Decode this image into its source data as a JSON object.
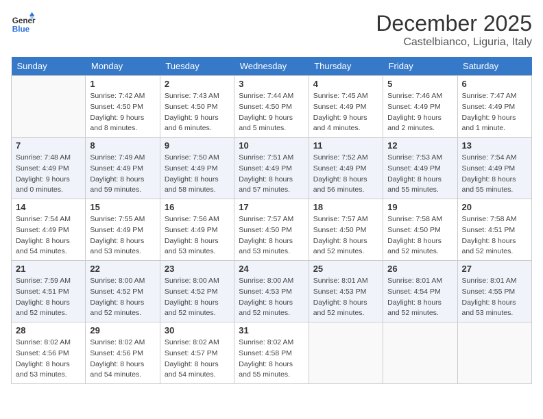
{
  "header": {
    "logo_general": "General",
    "logo_blue": "Blue",
    "month_title": "December 2025",
    "location": "Castelbianco, Liguria, Italy"
  },
  "days_of_week": [
    "Sunday",
    "Monday",
    "Tuesday",
    "Wednesday",
    "Thursday",
    "Friday",
    "Saturday"
  ],
  "weeks": [
    [
      {
        "day": "",
        "sunrise": "",
        "sunset": "",
        "daylight": ""
      },
      {
        "day": "1",
        "sunrise": "Sunrise: 7:42 AM",
        "sunset": "Sunset: 4:50 PM",
        "daylight": "Daylight: 9 hours and 8 minutes."
      },
      {
        "day": "2",
        "sunrise": "Sunrise: 7:43 AM",
        "sunset": "Sunset: 4:50 PM",
        "daylight": "Daylight: 9 hours and 6 minutes."
      },
      {
        "day": "3",
        "sunrise": "Sunrise: 7:44 AM",
        "sunset": "Sunset: 4:50 PM",
        "daylight": "Daylight: 9 hours and 5 minutes."
      },
      {
        "day": "4",
        "sunrise": "Sunrise: 7:45 AM",
        "sunset": "Sunset: 4:49 PM",
        "daylight": "Daylight: 9 hours and 4 minutes."
      },
      {
        "day": "5",
        "sunrise": "Sunrise: 7:46 AM",
        "sunset": "Sunset: 4:49 PM",
        "daylight": "Daylight: 9 hours and 2 minutes."
      },
      {
        "day": "6",
        "sunrise": "Sunrise: 7:47 AM",
        "sunset": "Sunset: 4:49 PM",
        "daylight": "Daylight: 9 hours and 1 minute."
      }
    ],
    [
      {
        "day": "7",
        "sunrise": "Sunrise: 7:48 AM",
        "sunset": "Sunset: 4:49 PM",
        "daylight": "Daylight: 9 hours and 0 minutes."
      },
      {
        "day": "8",
        "sunrise": "Sunrise: 7:49 AM",
        "sunset": "Sunset: 4:49 PM",
        "daylight": "Daylight: 8 hours and 59 minutes."
      },
      {
        "day": "9",
        "sunrise": "Sunrise: 7:50 AM",
        "sunset": "Sunset: 4:49 PM",
        "daylight": "Daylight: 8 hours and 58 minutes."
      },
      {
        "day": "10",
        "sunrise": "Sunrise: 7:51 AM",
        "sunset": "Sunset: 4:49 PM",
        "daylight": "Daylight: 8 hours and 57 minutes."
      },
      {
        "day": "11",
        "sunrise": "Sunrise: 7:52 AM",
        "sunset": "Sunset: 4:49 PM",
        "daylight": "Daylight: 8 hours and 56 minutes."
      },
      {
        "day": "12",
        "sunrise": "Sunrise: 7:53 AM",
        "sunset": "Sunset: 4:49 PM",
        "daylight": "Daylight: 8 hours and 55 minutes."
      },
      {
        "day": "13",
        "sunrise": "Sunrise: 7:54 AM",
        "sunset": "Sunset: 4:49 PM",
        "daylight": "Daylight: 8 hours and 55 minutes."
      }
    ],
    [
      {
        "day": "14",
        "sunrise": "Sunrise: 7:54 AM",
        "sunset": "Sunset: 4:49 PM",
        "daylight": "Daylight: 8 hours and 54 minutes."
      },
      {
        "day": "15",
        "sunrise": "Sunrise: 7:55 AM",
        "sunset": "Sunset: 4:49 PM",
        "daylight": "Daylight: 8 hours and 53 minutes."
      },
      {
        "day": "16",
        "sunrise": "Sunrise: 7:56 AM",
        "sunset": "Sunset: 4:49 PM",
        "daylight": "Daylight: 8 hours and 53 minutes."
      },
      {
        "day": "17",
        "sunrise": "Sunrise: 7:57 AM",
        "sunset": "Sunset: 4:50 PM",
        "daylight": "Daylight: 8 hours and 53 minutes."
      },
      {
        "day": "18",
        "sunrise": "Sunrise: 7:57 AM",
        "sunset": "Sunset: 4:50 PM",
        "daylight": "Daylight: 8 hours and 52 minutes."
      },
      {
        "day": "19",
        "sunrise": "Sunrise: 7:58 AM",
        "sunset": "Sunset: 4:50 PM",
        "daylight": "Daylight: 8 hours and 52 minutes."
      },
      {
        "day": "20",
        "sunrise": "Sunrise: 7:58 AM",
        "sunset": "Sunset: 4:51 PM",
        "daylight": "Daylight: 8 hours and 52 minutes."
      }
    ],
    [
      {
        "day": "21",
        "sunrise": "Sunrise: 7:59 AM",
        "sunset": "Sunset: 4:51 PM",
        "daylight": "Daylight: 8 hours and 52 minutes."
      },
      {
        "day": "22",
        "sunrise": "Sunrise: 8:00 AM",
        "sunset": "Sunset: 4:52 PM",
        "daylight": "Daylight: 8 hours and 52 minutes."
      },
      {
        "day": "23",
        "sunrise": "Sunrise: 8:00 AM",
        "sunset": "Sunset: 4:52 PM",
        "daylight": "Daylight: 8 hours and 52 minutes."
      },
      {
        "day": "24",
        "sunrise": "Sunrise: 8:00 AM",
        "sunset": "Sunset: 4:53 PM",
        "daylight": "Daylight: 8 hours and 52 minutes."
      },
      {
        "day": "25",
        "sunrise": "Sunrise: 8:01 AM",
        "sunset": "Sunset: 4:53 PM",
        "daylight": "Daylight: 8 hours and 52 minutes."
      },
      {
        "day": "26",
        "sunrise": "Sunrise: 8:01 AM",
        "sunset": "Sunset: 4:54 PM",
        "daylight": "Daylight: 8 hours and 52 minutes."
      },
      {
        "day": "27",
        "sunrise": "Sunrise: 8:01 AM",
        "sunset": "Sunset: 4:55 PM",
        "daylight": "Daylight: 8 hours and 53 minutes."
      }
    ],
    [
      {
        "day": "28",
        "sunrise": "Sunrise: 8:02 AM",
        "sunset": "Sunset: 4:56 PM",
        "daylight": "Daylight: 8 hours and 53 minutes."
      },
      {
        "day": "29",
        "sunrise": "Sunrise: 8:02 AM",
        "sunset": "Sunset: 4:56 PM",
        "daylight": "Daylight: 8 hours and 54 minutes."
      },
      {
        "day": "30",
        "sunrise": "Sunrise: 8:02 AM",
        "sunset": "Sunset: 4:57 PM",
        "daylight": "Daylight: 8 hours and 54 minutes."
      },
      {
        "day": "31",
        "sunrise": "Sunrise: 8:02 AM",
        "sunset": "Sunset: 4:58 PM",
        "daylight": "Daylight: 8 hours and 55 minutes."
      },
      {
        "day": "",
        "sunrise": "",
        "sunset": "",
        "daylight": ""
      },
      {
        "day": "",
        "sunrise": "",
        "sunset": "",
        "daylight": ""
      },
      {
        "day": "",
        "sunrise": "",
        "sunset": "",
        "daylight": ""
      }
    ]
  ]
}
